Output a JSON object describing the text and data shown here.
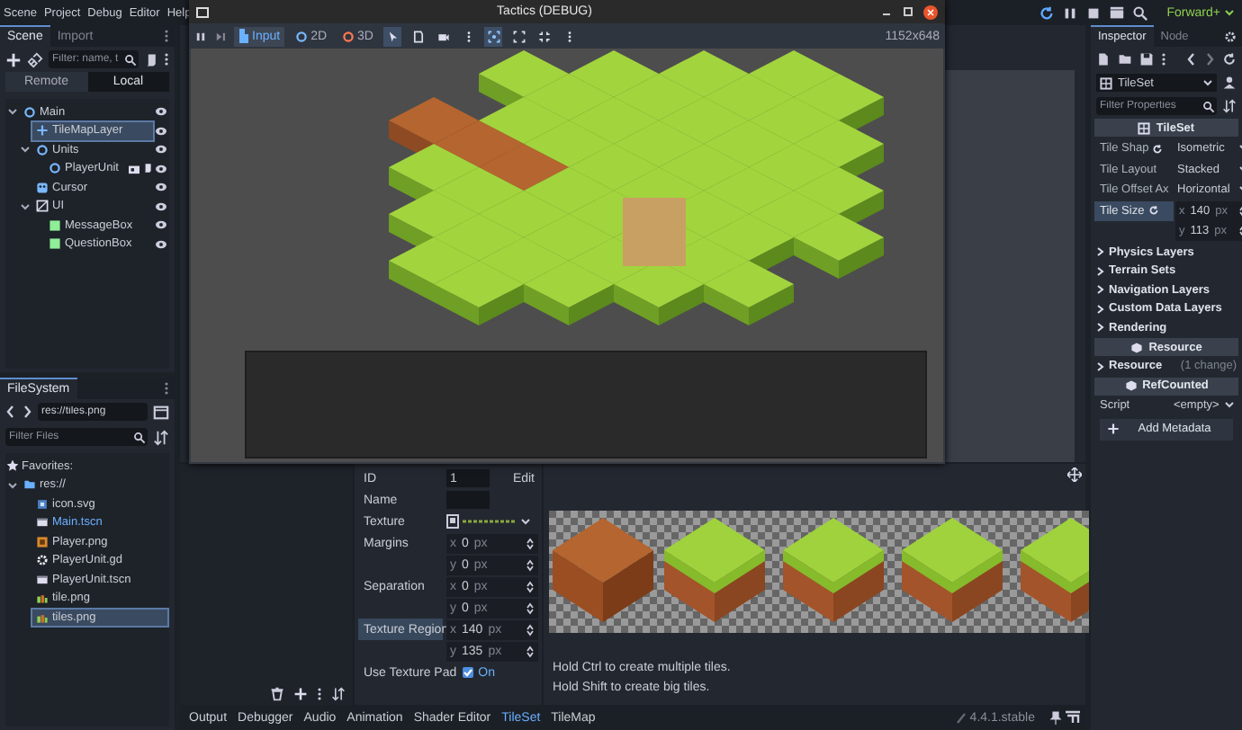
{
  "menu": [
    "Scene",
    "Project",
    "Debug",
    "Editor",
    "Help"
  ],
  "renderer": "Forward+",
  "scene_dock": {
    "tabs": [
      {
        "label": "Scene",
        "selected": true
      },
      {
        "label": "Import",
        "selected": false
      }
    ],
    "filter": {
      "placeholder": "Filter: name, t"
    },
    "modes": [
      {
        "label": "Remote",
        "selected": false
      },
      {
        "label": "Local",
        "selected": true
      }
    ],
    "tree": [
      {
        "name": "Main",
        "kind": "node",
        "selected": false,
        "instanced": false,
        "children": [
          {
            "name": "TileMapLayer",
            "kind": "tilemap",
            "selected": true,
            "instanced": false
          },
          {
            "name": "Units",
            "kind": "node",
            "selected": false,
            "instanced": false,
            "children": [
              {
                "name": "PlayerUnit",
                "kind": "node",
                "selected": false,
                "instanced": true
              }
            ]
          },
          {
            "name": "Cursor",
            "kind": "sprite",
            "selected": false,
            "instanced": false
          },
          {
            "name": "UI",
            "kind": "control",
            "selected": false,
            "instanced": false,
            "children": [
              {
                "name": "MessageBox",
                "kind": "panel",
                "selected": false,
                "instanced": false
              },
              {
                "name": "QuestionBox",
                "kind": "panel",
                "selected": false,
                "instanced": false
              }
            ]
          }
        ]
      }
    ]
  },
  "filesystem": {
    "tab": "FileSystem",
    "path": "res://tiles.png",
    "filter": {
      "placeholder": "Filter Files"
    },
    "favorites": "Favorites:",
    "tree": [
      {
        "name": "res://",
        "kind": "folder",
        "selected": false,
        "current": false,
        "children": [
          {
            "name": "icon.svg",
            "kind": "svg",
            "selected": false,
            "current": false
          },
          {
            "name": "Main.tscn",
            "kind": "scene",
            "selected": false,
            "current": true
          },
          {
            "name": "Player.png",
            "kind": "image",
            "selected": false,
            "current": false
          },
          {
            "name": "PlayerUnit.gd",
            "kind": "script",
            "selected": false,
            "current": false
          },
          {
            "name": "PlayerUnit.tscn",
            "kind": "scene",
            "selected": false,
            "current": false
          },
          {
            "name": "tile.png",
            "kind": "tile",
            "selected": false,
            "current": false
          },
          {
            "name": "tiles.png",
            "kind": "tile",
            "selected": true,
            "current": false
          }
        ]
      }
    ]
  },
  "game_window": {
    "title": "Tactics (DEBUG)",
    "modes": [
      {
        "label": "Input",
        "kind": "input",
        "selected": true
      },
      {
        "label": "2D",
        "kind": "canvas",
        "selected": false
      },
      {
        "label": "3D",
        "kind": "spatial",
        "selected": false
      }
    ],
    "tools": [
      {
        "kind": "pointer",
        "selected": true
      },
      {
        "kind": "list",
        "selected": false
      },
      {
        "kind": "camera",
        "selected": false
      },
      {
        "kind": "more",
        "selected": false
      },
      {
        "kind": "frame",
        "selected": true
      },
      {
        "kind": "expand",
        "selected": false
      },
      {
        "kind": "shrink",
        "selected": false
      },
      {
        "kind": "more",
        "selected": false
      }
    ],
    "resolution": "1152x648"
  },
  "bottom_panel": {
    "props": [
      {
        "kind": "text",
        "label": "ID",
        "value": "1",
        "action": "Edit",
        "selected": false
      },
      {
        "kind": "text",
        "label": "Name",
        "selected": false
      },
      {
        "kind": "texture",
        "label": "Texture",
        "selected": false
      },
      {
        "kind": "vector",
        "label": "Margins",
        "fields": [
          {
            "axis": "x",
            "value": "0",
            "unit": "px"
          },
          {
            "axis": "y",
            "value": "0",
            "unit": "px"
          }
        ],
        "selected": false
      },
      {
        "kind": "vector",
        "label": "Separation",
        "fields": [
          {
            "axis": "x",
            "value": "0",
            "unit": "px"
          },
          {
            "axis": "y",
            "value": "0",
            "unit": "px"
          }
        ],
        "selected": false
      },
      {
        "kind": "vector",
        "label": "Texture Region",
        "fields": [
          {
            "axis": "x",
            "value": "140",
            "unit": "px"
          },
          {
            "axis": "y",
            "value": "135",
            "unit": "px"
          }
        ],
        "selected": true
      },
      {
        "kind": "check",
        "label": "Use Texture Pad",
        "value": "On",
        "checked": true,
        "selected": false
      }
    ],
    "hints": [
      "Hold Ctrl to create multiple tiles.",
      "Hold Shift to create big tiles."
    ],
    "tabs": [
      {
        "label": "Output",
        "selected": false
      },
      {
        "label": "Debugger",
        "selected": false
      },
      {
        "label": "Audio",
        "selected": false
      },
      {
        "label": "Animation",
        "selected": false
      },
      {
        "label": "Shader Editor",
        "selected": false
      },
      {
        "label": "TileSet",
        "selected": true
      },
      {
        "label": "TileMap",
        "selected": false
      }
    ],
    "version": "4.4.1.stable"
  },
  "inspector": {
    "tabs": [
      {
        "label": "Inspector",
        "selected": true
      },
      {
        "label": "Node",
        "selected": false
      }
    ],
    "resource": "TileSet",
    "filter": {
      "placeholder": "Filter Properties"
    },
    "class_header": "TileSet",
    "props": [
      {
        "kind": "enum",
        "label": "Tile Shap",
        "value": "Isometric",
        "modified": true,
        "selected": false
      },
      {
        "kind": "enum",
        "label": "Tile Layout",
        "value": "Stacked",
        "modified": false,
        "selected": false
      },
      {
        "kind": "enum",
        "label": "Tile Offset Ax",
        "value": "Horizontal",
        "modified": false,
        "selected": false
      },
      {
        "kind": "vector",
        "label": "Tile Size",
        "fields": [
          {
            "axis": "x",
            "value": "140",
            "unit": "px"
          },
          {
            "axis": "y",
            "value": "113",
            "unit": "px"
          }
        ],
        "modified": true,
        "selected": true
      }
    ],
    "sections": [
      {
        "label": "Physics Layers",
        "expanded": false
      },
      {
        "label": "Terrain Sets",
        "expanded": false
      },
      {
        "label": "Navigation Layers",
        "expanded": false
      },
      {
        "label": "Custom Data Layers",
        "expanded": false
      },
      {
        "label": "Rendering",
        "expanded": false
      }
    ],
    "resource_header": "Resource",
    "resource_row": {
      "label": "Resource",
      "note": "(1 change)"
    },
    "refcounted_header": "RefCounted",
    "script_row": {
      "label": "Script",
      "value": "<empty>"
    },
    "add_metadata": "Add Metadata"
  }
}
